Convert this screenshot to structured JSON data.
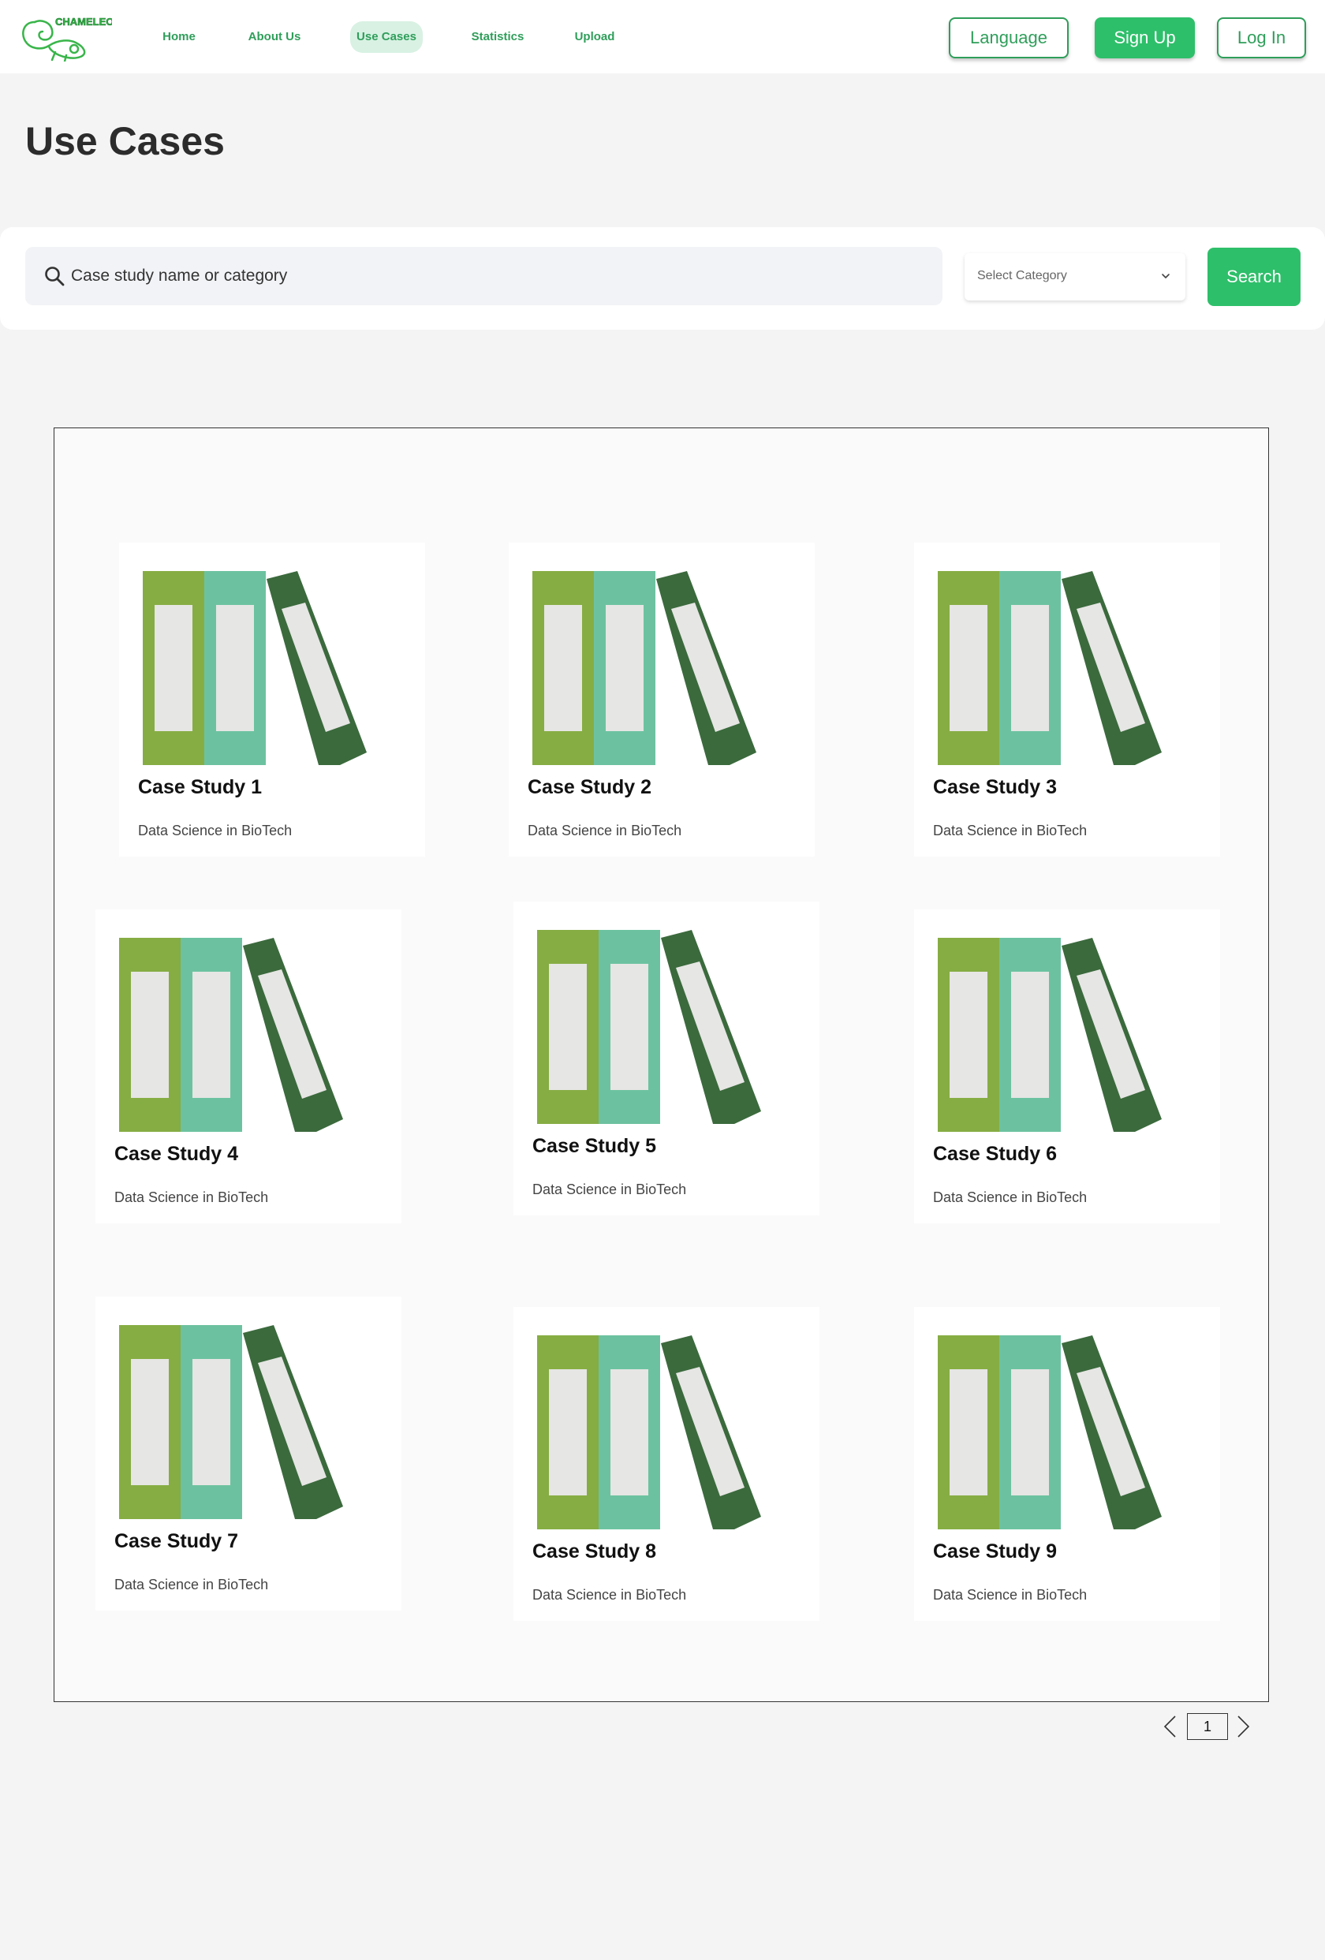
{
  "header": {
    "logo_text": "CHAMELEON",
    "nav": [
      {
        "label": "Home",
        "active": false
      },
      {
        "label": "About Us",
        "active": false
      },
      {
        "label": "Use Cases",
        "active": true
      },
      {
        "label": "Statistics",
        "active": false
      },
      {
        "label": "Upload",
        "active": false
      }
    ],
    "language_label": "Language",
    "signup_label": "Sign Up",
    "login_label": "Log In"
  },
  "page": {
    "title": "Use Cases"
  },
  "search": {
    "placeholder": "Case study name or category",
    "category_placeholder": "Select Category",
    "button_label": "Search"
  },
  "cards": [
    {
      "title": "Case Study 1",
      "subtitle": "Data Science in BioTech"
    },
    {
      "title": "Case Study 2",
      "subtitle": "Data Science in BioTech"
    },
    {
      "title": "Case Study 3",
      "subtitle": "Data Science in BioTech"
    },
    {
      "title": "Case Study 4",
      "subtitle": "Data Science in BioTech"
    },
    {
      "title": "Case Study 5",
      "subtitle": "Data Science in BioTech"
    },
    {
      "title": "Case Study 6",
      "subtitle": "Data Science in BioTech"
    },
    {
      "title": "Case Study 7",
      "subtitle": "Data Science in BioTech"
    },
    {
      "title": "Case Study 8",
      "subtitle": "Data Science in BioTech"
    },
    {
      "title": "Case Study 9",
      "subtitle": "Data Science in BioTech"
    }
  ],
  "pagination": {
    "current_page": "1"
  },
  "colors": {
    "brand_green": "#2ebf6a",
    "binder_olive": "#86ad43",
    "binder_teal": "#6cc2a0",
    "binder_dark": "#3b6a3d",
    "binder_label": "#e6e6e4"
  },
  "icons": {
    "logo": "chameleon-logo-icon",
    "search": "search-icon",
    "dropdown": "chevron-down-icon",
    "prev": "chevron-left-icon",
    "next": "chevron-right-icon",
    "card_image": "binders-icon"
  }
}
